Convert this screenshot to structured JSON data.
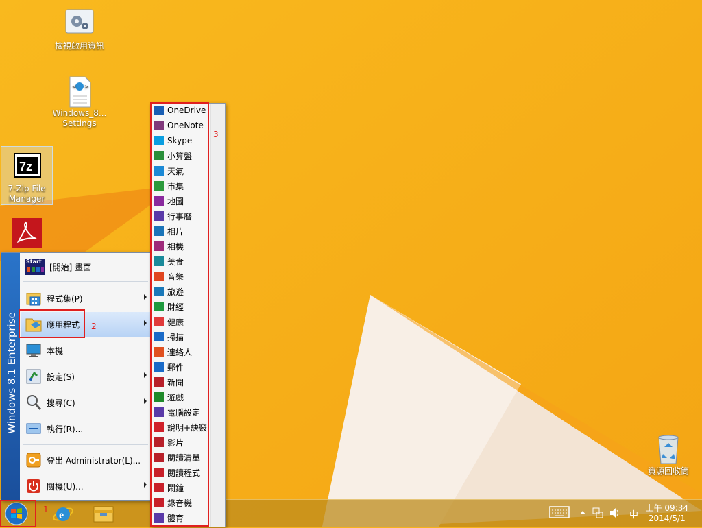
{
  "desktop": {
    "icons": [
      {
        "label": "檢視啟用資訊"
      },
      {
        "label": "Windows_8...\nSettings"
      },
      {
        "label": "7-Zip File\nManager"
      },
      {
        "label": ""
      },
      {
        "label": "資源回收筒"
      }
    ]
  },
  "start_menu": {
    "banner": "Windows 8.1 Enterprise",
    "items": [
      {
        "label": "[開始] 畫面",
        "icon": "start-screen-icon"
      },
      {
        "label": "程式集(P)",
        "icon": "programs-icon"
      },
      {
        "label": "應用程式",
        "icon": "apps-folder-icon"
      },
      {
        "label": "本機",
        "icon": "computer-icon"
      },
      {
        "label": "設定(S)",
        "icon": "settings-icon"
      },
      {
        "label": "搜尋(C)",
        "icon": "search-icon"
      },
      {
        "label": "執行(R)...",
        "icon": "run-icon"
      },
      {
        "label": "登出 Administrator(L)...",
        "icon": "logoff-icon"
      },
      {
        "label": "關機(U)...",
        "icon": "power-icon"
      }
    ],
    "start_tile_text": "Start"
  },
  "submenu": {
    "items": [
      {
        "label": "OneDrive",
        "color": "#1a5fb4"
      },
      {
        "label": "OneNote",
        "color": "#80397b"
      },
      {
        "label": "Skype",
        "color": "#0a9ee0"
      },
      {
        "label": "小算盤",
        "color": "#2a8f3a"
      },
      {
        "label": "天氣",
        "color": "#1c8ad6"
      },
      {
        "label": "市集",
        "color": "#2c9a3c"
      },
      {
        "label": "地圖",
        "color": "#8a2a9e"
      },
      {
        "label": "行事曆",
        "color": "#5a3aa8"
      },
      {
        "label": "相片",
        "color": "#1a74b8"
      },
      {
        "label": "相機",
        "color": "#9e2a7a"
      },
      {
        "label": "美食",
        "color": "#1a8a9a"
      },
      {
        "label": "音樂",
        "color": "#e0451f"
      },
      {
        "label": "旅遊",
        "color": "#1a78b8"
      },
      {
        "label": "財經",
        "color": "#1f9a3e"
      },
      {
        "label": "健康",
        "color": "#e03a3a"
      },
      {
        "label": "掃描",
        "color": "#1a6ac8"
      },
      {
        "label": "連絡人",
        "color": "#e0501f"
      },
      {
        "label": "郵件",
        "color": "#1a6ac8"
      },
      {
        "label": "新聞",
        "color": "#b8202a"
      },
      {
        "label": "遊戲",
        "color": "#1f8a2a"
      },
      {
        "label": "電腦設定",
        "color": "#5a3aa8"
      },
      {
        "label": "說明+訣竅",
        "color": "#d0202a"
      },
      {
        "label": "影片",
        "color": "#b8202a"
      },
      {
        "label": "閱讀清單",
        "color": "#b8202a"
      },
      {
        "label": "閱讀程式",
        "color": "#c8202a"
      },
      {
        "label": "鬧鐘",
        "color": "#c8202a"
      },
      {
        "label": "錄音機",
        "color": "#c8202a"
      },
      {
        "label": "體育",
        "color": "#5a3aa8"
      }
    ]
  },
  "annotations": {
    "one": "1",
    "two": "2",
    "three": "3"
  },
  "taskbar": {
    "time": "上午 09:34",
    "date": "2014/5/1",
    "ime": "中"
  }
}
